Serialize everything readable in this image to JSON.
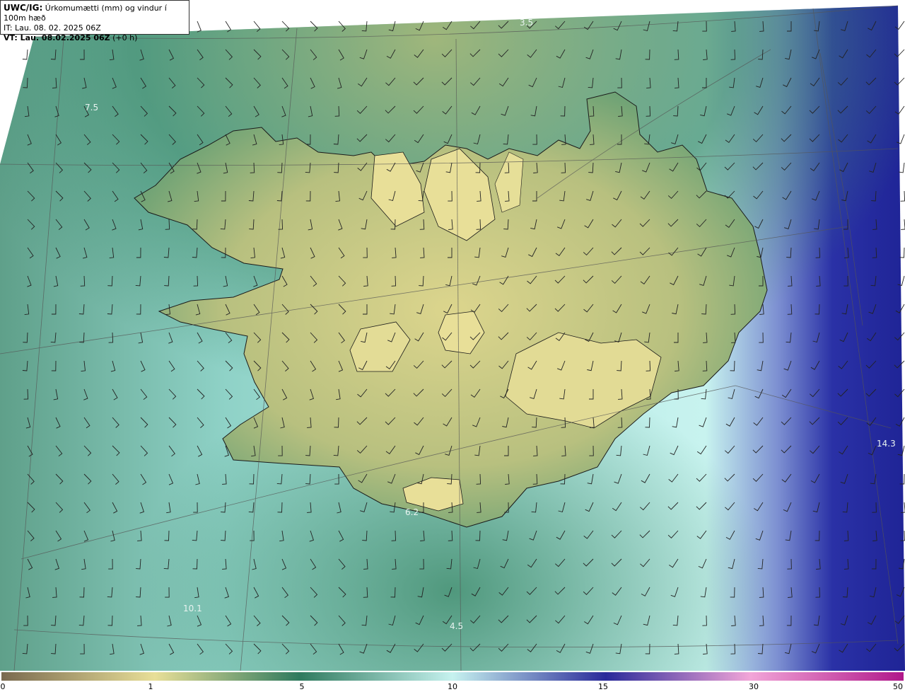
{
  "header": {
    "code": "UWC/IG:",
    "title": "Úrkomumætti (mm) og vindur í 100m hæð",
    "issue_time": "IT: Lau. 08. 02. 2025 06Z",
    "valid_label": "VT: Lau. 08.02.2025 06Z",
    "valid_offset": "(+0 h)"
  },
  "value_labels": [
    "3.5",
    "7.5",
    "14.3",
    "6.2",
    "4.5",
    "10.1"
  ],
  "colorbar": {
    "ticks": [
      "0",
      "1",
      "5",
      "10",
      "15",
      "30",
      "50"
    ],
    "colors": [
      "#7a6a4f",
      "#e8df98",
      "#2f7a5e",
      "#c6f2ef",
      "#2a2a9a",
      "#f2a5d8",
      "#b0188a"
    ]
  },
  "map_colors": {
    "land_high": "#e6df98",
    "land_mid": "#b3bf7f",
    "coast_green": "#3f8a6b",
    "sea_cyan": "#b8ece8",
    "sea_deep": "#2a2da0",
    "coastline": "#1a1a1a",
    "graticule": "#555555",
    "wind_barb": "#222222"
  }
}
